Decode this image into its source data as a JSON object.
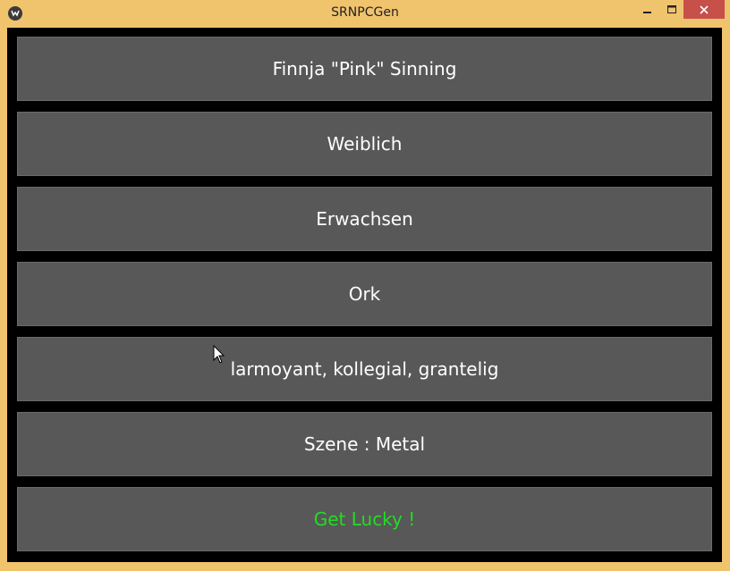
{
  "window": {
    "title": "SRNPCGen",
    "controls": {
      "minimize_icon": "minimize-icon",
      "maximize_icon": "maximize-icon",
      "close_icon": "close-icon"
    },
    "frame_color": "#f0c36d",
    "close_color": "#c7504a"
  },
  "npc": {
    "name": "Finnja \"Pink\" Sinning",
    "gender": "Weiblich",
    "age": "Erwachsen",
    "race": "Ork",
    "traits": "larmoyant, kollegial, grantelig",
    "scene": "Szene : Metal",
    "lucky_label": "Get Lucky !"
  },
  "colors": {
    "button_bg": "#585858",
    "button_text": "#ffffff",
    "lucky_text": "#22dd22",
    "background": "#000000"
  }
}
